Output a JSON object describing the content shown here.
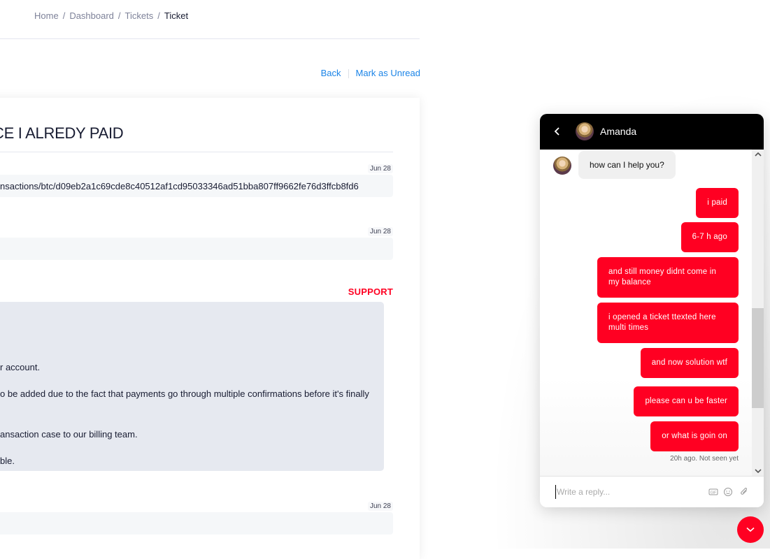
{
  "breadcrumb": [
    "Home",
    "Dashboard",
    "Tickets",
    "Ticket"
  ],
  "actions": {
    "back": "Back",
    "mark_unread": "Mark as Unread"
  },
  "ticket": {
    "title": "CE I ALREDY PAID",
    "messages": [
      {
        "date": "Jun 28",
        "text": "nsactions/btc/d09eb2a1c69cde8c40512af1cd95033346ad51bba807ff9662fe76d3ffcb8fd6"
      },
      {
        "date": "Jun 28",
        "text": ""
      },
      {
        "date": "Jun 28",
        "text": ""
      }
    ],
    "support": {
      "label": "SUPPORT",
      "lines": [
        "r account.",
        "o be added due to the fact that payments go through multiple confirmations before it's finally",
        "ansaction case to our billing team.",
        "ble."
      ]
    }
  },
  "chat": {
    "agent_name": "Amanda",
    "incoming": "how can I help you?",
    "outgoing": [
      "i paid",
      "6-7 h ago",
      "and still money didnt come in my balance",
      "i opened a ticket ttexted here multi times",
      "and now solution wtf",
      "please can u be faster",
      "or what is goin on"
    ],
    "status": "20h ago. Not seen yet",
    "reply_placeholder": "Write a reply...",
    "brand_color": "#ff0022",
    "scroll_position_fraction": 0.72
  }
}
